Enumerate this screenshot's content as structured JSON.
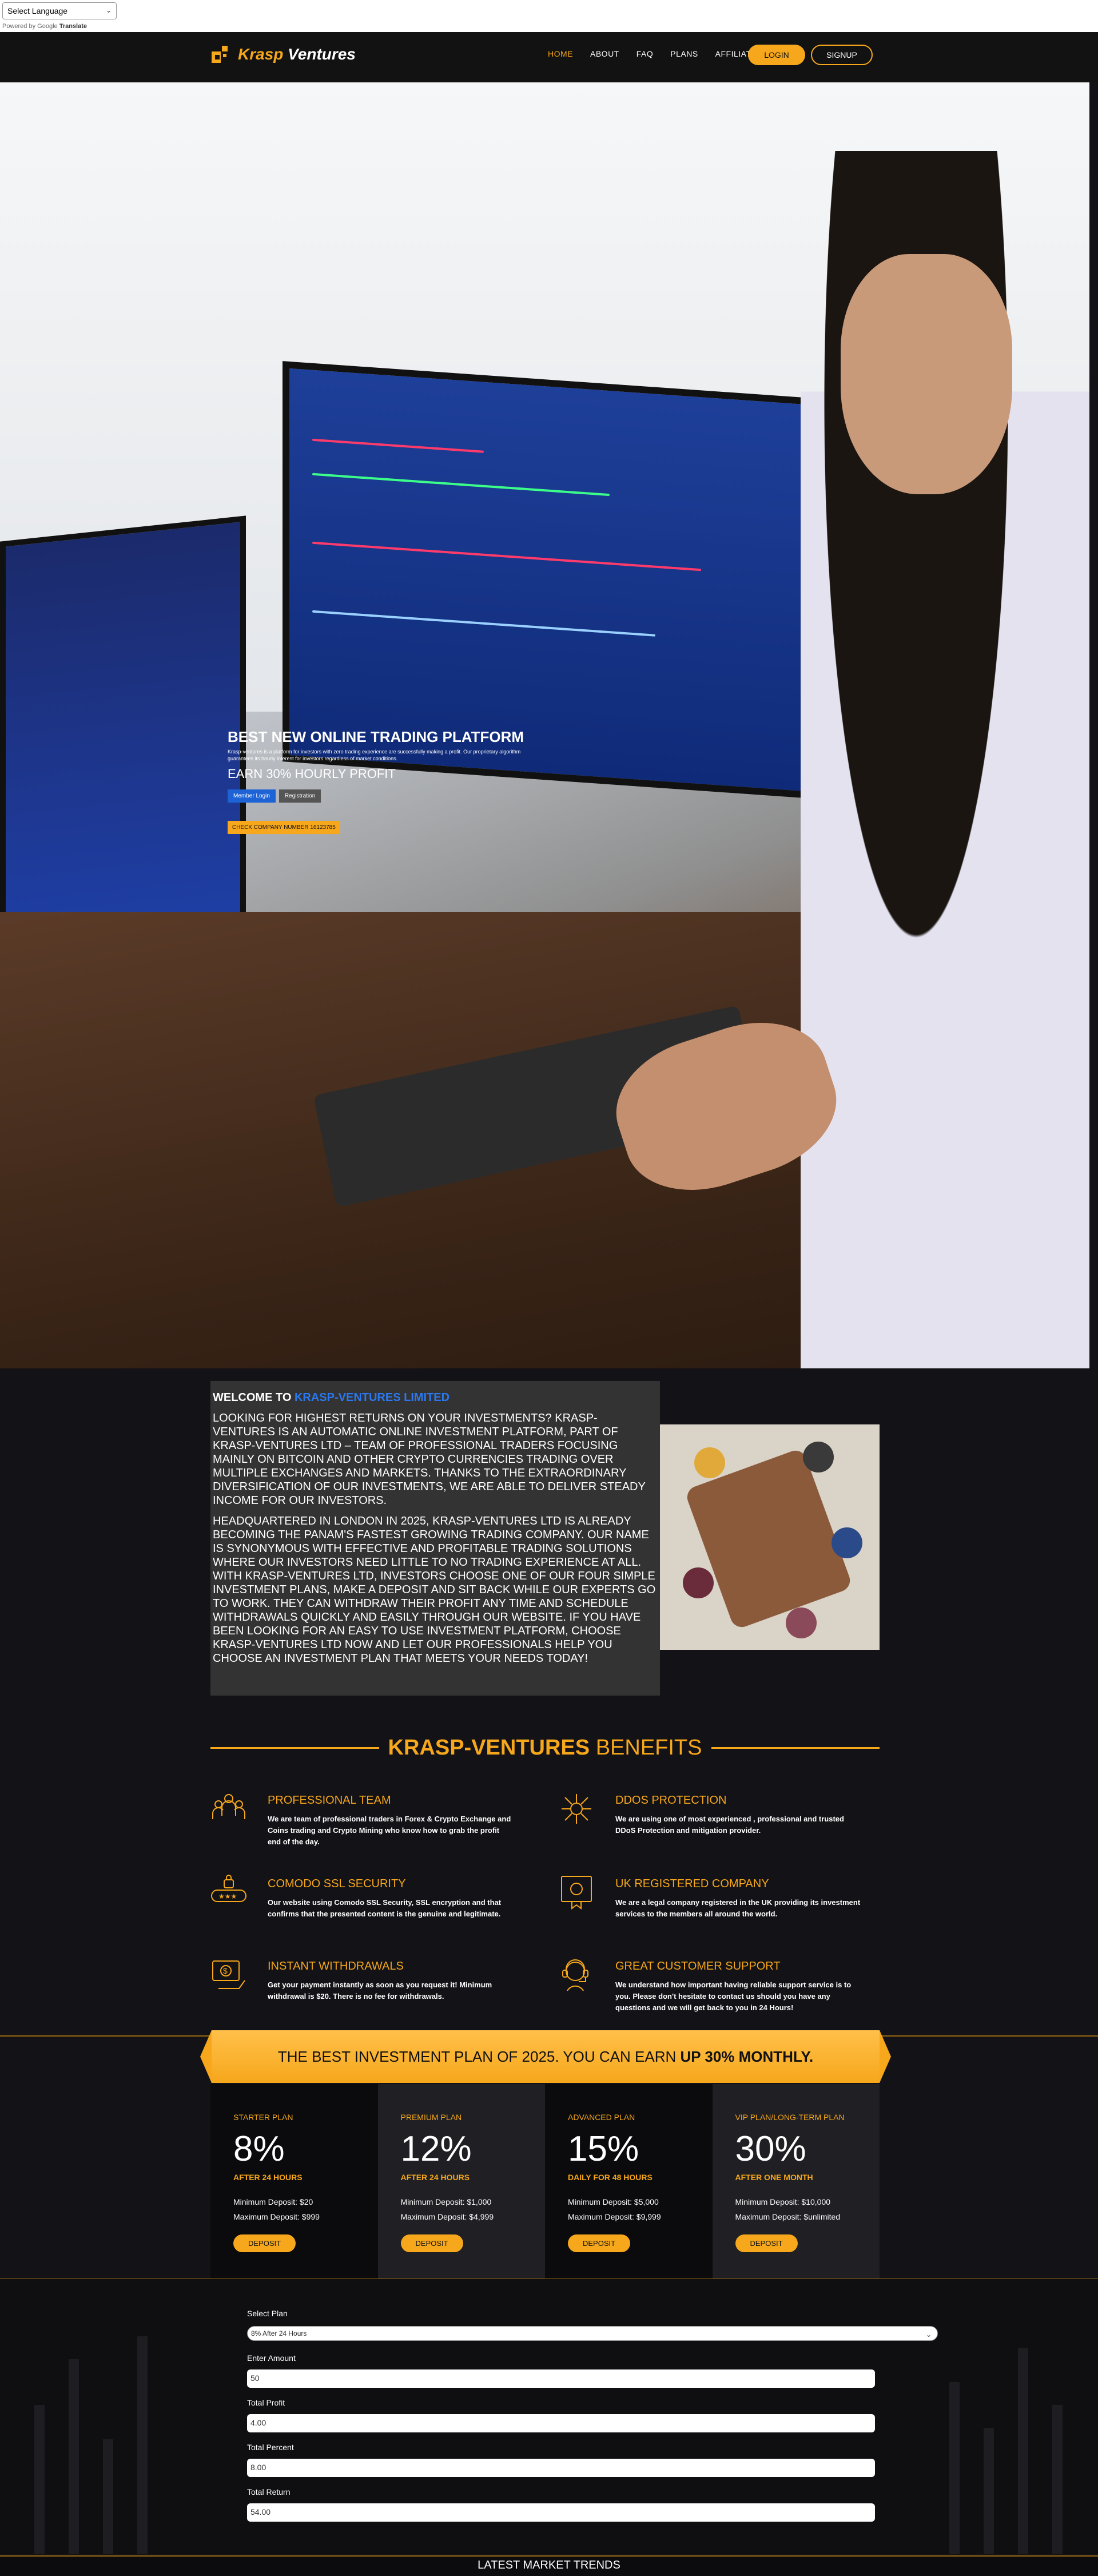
{
  "translate": {
    "select_label": "Select Language",
    "powered_by": "Powered by",
    "google": "Google",
    "translate": "Translate"
  },
  "header": {
    "logo_part1": "Krasp",
    "logo_part2": "Ventures",
    "nav": [
      "HOME",
      "ABOUT",
      "FAQ",
      "PLANS",
      "AFFILIATES"
    ],
    "login": "LOGIN",
    "signup": "SIGNUP"
  },
  "hero": {
    "title": "BEST NEW ONLINE TRADING PLATFORM",
    "subtitle": "Krasp-ventures is a platform for investors with zero trading experience are successfully making a profit. Our proprietary algorithm guarantees its hourly interest for investors regardless of market conditions.",
    "profit": "EARN 30% HOURLY PROFIT",
    "member_login": "Member Login",
    "registration": "Registration",
    "company_number": "CHECK COMPANY NUMBER 16123785"
  },
  "welcome": {
    "heading_prefix": "WELCOME TO",
    "heading_brand": "KRASP-VENTURES LIMITED",
    "para1": "LOOKING FOR HIGHEST RETURNS ON YOUR INVESTMENTS? KRASP-VENTURES IS AN AUTOMATIC ONLINE INVESTMENT PLATFORM, PART OF KRASP-VENTURES LTD – TEAM OF PROFESSIONAL TRADERS FOCUSING MAINLY ON BITCOIN AND OTHER CRYPTO CURRENCIES TRADING OVER MULTIPLE EXCHANGES AND MARKETS. THANKS TO THE EXTRAORDINARY DIVERSIFICATION OF OUR INVESTMENTS, WE ARE ABLE TO DELIVER STEADY INCOME FOR OUR INVESTORS.",
    "para2": "HEADQUARTERED IN LONDON IN 2025, KRASP-VENTURES LTD IS ALREADY BECOMING THE PANAM'S FASTEST GROWING TRADING COMPANY. OUR NAME IS SYNONYMOUS WITH EFFECTIVE AND PROFITABLE TRADING SOLUTIONS WHERE OUR INVESTORS NEED LITTLE TO NO TRADING EXPERIENCE AT ALL. WITH KRASP-VENTURES LTD, INVESTORS CHOOSE ONE OF OUR FOUR SIMPLE INVESTMENT PLANS, MAKE A DEPOSIT AND SIT BACK WHILE OUR EXPERTS GO TO WORK. THEY CAN WITHDRAW THEIR PROFIT ANY TIME AND SCHEDULE WITHDRAWALS QUICKLY AND EASILY THROUGH OUR WEBSITE. IF YOU HAVE BEEN LOOKING FOR AN EASY TO USE INVESTMENT PLATFORM, CHOOSE KRASP-VENTURES LTD NOW AND LET OUR PROFESSIONALS HELP YOU CHOOSE AN INVESTMENT PLAN THAT MEETS YOUR NEEDS TODAY!"
  },
  "benefits": {
    "title_bold": "KRASP-VENTURES",
    "title_rest": "BENEFITS",
    "items": [
      {
        "title": "PROFESSIONAL TEAM",
        "text": "We are team of professional traders in Forex & Crypto Exchange and Coins trading and Crypto Mining who know how to grab the profit end of the day."
      },
      {
        "title": "DDOS PROTECTION",
        "text": "We are using one of most experienced , professional and trusted DDoS Protection and mitigation provider."
      },
      {
        "title": "COMODO SSL SECURITY",
        "text": "Our website using Comodo SSL Security, SSL encryption and that confirms that the presented content is the genuine and legitimate."
      },
      {
        "title": "UK REGISTERED COMPANY",
        "text": "We are a legal company registered in the UK providing its investment services to the members all around the world."
      },
      {
        "title": "INSTANT WITHDRAWALS",
        "text": "Get your payment instantly as soon as you request it! Minimum withdrawal is $20. There is no fee for withdrawals."
      },
      {
        "title": "GREAT CUSTOMER SUPPORT",
        "text": "We understand how important having reliable support service is to you. Please don't hesitate to contact us should you have any questions and we will get back to you in 24 Hours!"
      }
    ]
  },
  "banner": {
    "text": "THE BEST INVESTMENT PLAN OF 2025. YOU CAN EARN",
    "bold": "UP 30% MONTHLY."
  },
  "plans": [
    {
      "name": "STARTER PLAN",
      "pct": "8%",
      "dur": "AFTER 24 HOURS",
      "min": "Minimum Deposit: $20",
      "max": "Maximum Deposit: $999",
      "btn": "DEPOSIT"
    },
    {
      "name": "PREMIUM PLAN",
      "pct": "12%",
      "dur": "AFTER 24 HOURS",
      "min": "Minimum Deposit: $1,000",
      "max": "Maximum Deposit: $4,999",
      "btn": "DEPOSIT"
    },
    {
      "name": "ADVANCED PLAN",
      "pct": "15%",
      "dur": "DAILY FOR 48 HOURS",
      "min": "Minimum Deposit: $5,000",
      "max": "Maximum Deposit: $9,999",
      "btn": "DEPOSIT"
    },
    {
      "name": "VIP PLAN/LONG-TERM PLAN",
      "pct": "30%",
      "dur": "AFTER ONE MONTH",
      "min": "Minimum Deposit: $10,000",
      "max": "Maximum Deposit: $unlimited",
      "btn": "DEPOSIT"
    }
  ],
  "calculator": {
    "select_plan_label": "Select Plan",
    "select_plan_value": "8% After 24 Hours",
    "amount_label": "Enter Amount",
    "amount_value": "50",
    "profit_label": "Total Profit",
    "profit_value": "4.00",
    "percent_label": "Total Percent",
    "percent_value": "8.00",
    "return_label": "Total Return",
    "return_value": "54.00"
  },
  "trends": {
    "title": "LATEST MARKET TRENDS"
  },
  "colors": {
    "accent": "#f6a71b",
    "brand_blue": "#2a78f0",
    "background": "#131217"
  }
}
